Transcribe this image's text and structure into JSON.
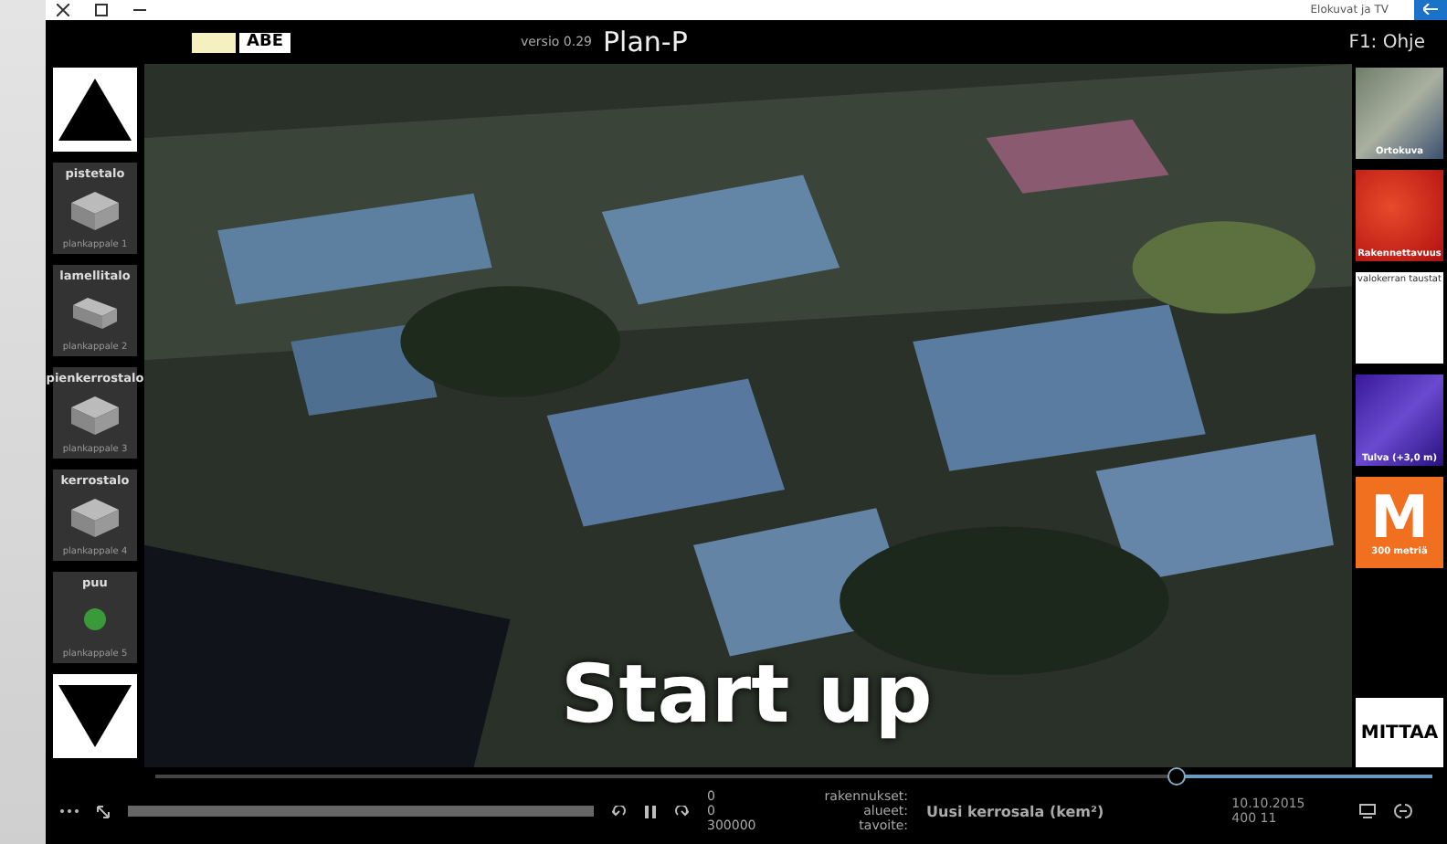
{
  "window": {
    "title": "Elokuvat ja TV"
  },
  "header": {
    "help": "F1: Ohje",
    "app_name": "Plan-P",
    "version": "versio 0.29",
    "logo": "ABE"
  },
  "left_panel": {
    "items": [
      {
        "name": "pistetalo",
        "sub": "plankappale 1",
        "kind": "block"
      },
      {
        "name": "lamellitalo",
        "sub": "plankappale 2",
        "kind": "bar"
      },
      {
        "name": "pienkerrostalo",
        "sub": "plankappale 3",
        "kind": "block"
      },
      {
        "name": "kerrostalo",
        "sub": "plankappale 4",
        "kind": "block"
      },
      {
        "name": "puu",
        "sub": "plankappale 5",
        "kind": "tree"
      }
    ]
  },
  "right_panel": {
    "items": [
      {
        "label": "Ortokuva",
        "kind": "ortho"
      },
      {
        "label": "Rakennettavuus",
        "kind": "heat"
      },
      {
        "label": "valokerran taustat",
        "kind": "blank"
      },
      {
        "label": "Tulva (+3,0 m)",
        "kind": "flood"
      },
      {
        "label": "300 metriä",
        "letter": "M",
        "kind": "measure"
      }
    ],
    "measure_button": "MITTAA"
  },
  "subtitle": "Start up",
  "status": {
    "date": "10.10.2015",
    "zoom": "400 11",
    "metric_title": "Uusi kerrosala (kem²)",
    "stats": [
      {
        "label": "rakennukset:",
        "value": "0"
      },
      {
        "label": "alueet:",
        "value": "0"
      },
      {
        "label": "tavoite:",
        "value": "300000"
      }
    ]
  },
  "timeline": {
    "level": 0.2
  }
}
